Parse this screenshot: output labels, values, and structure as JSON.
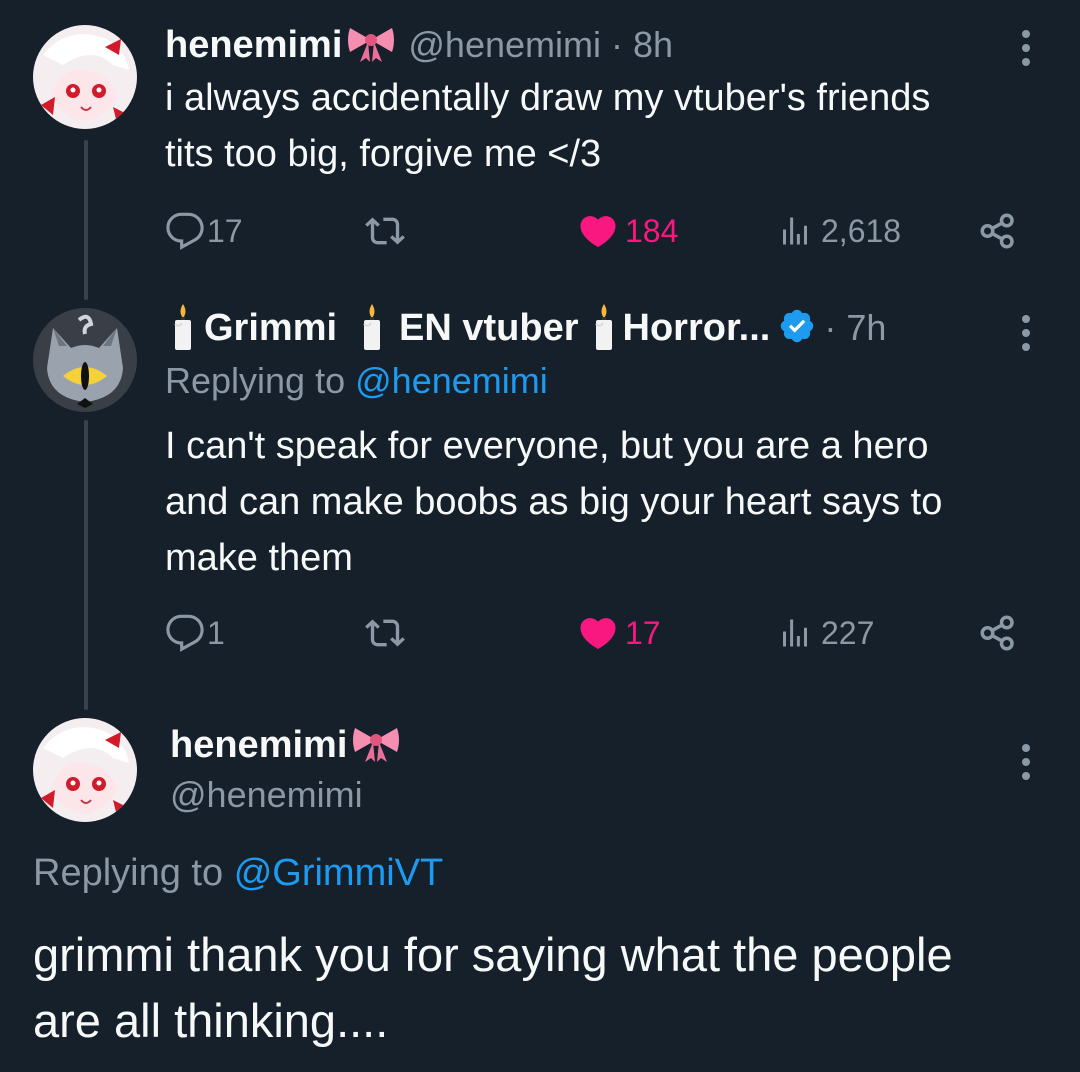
{
  "tweet1": {
    "name": "henemimi",
    "handle": "@henemimi",
    "time": "· 8h",
    "text_line1": "i always accidentally draw my vtuber's friends",
    "text_line2": "tits too big, forgive me </3",
    "replies": "17",
    "likes": "184",
    "views": "2,618"
  },
  "tweet2": {
    "name_part1": "Grimmi",
    "name_part2": "EN vtuber",
    "name_part3": "Horror...",
    "time": "· 7h",
    "replying_prefix": "Replying to",
    "replying_handle": "@henemimi",
    "text_line1": "I can't speak for everyone, but you are a hero",
    "text_line2": "and can make boobs as big your heart says to",
    "text_line3": "make them",
    "replies": "1",
    "likes": "17",
    "views": "227"
  },
  "tweet3": {
    "name": "henemimi",
    "handle": "@henemimi",
    "replying_prefix": "Replying to",
    "replying_handle": "@GrimmiVT",
    "text_line1": "grimmi thank you for saying what the people",
    "text_line2": "are all thinking...."
  },
  "colors": {
    "background": "#15202b",
    "text": "#f7f9f9",
    "muted": "#8b98a5",
    "link": "#1d9bf0",
    "like": "#f91880",
    "verified": "#1d9bf0",
    "thread_line": "#38444d"
  },
  "icons": [
    "reply-icon",
    "retweet-icon",
    "heart-icon",
    "views-icon",
    "share-icon",
    "more-icon",
    "bow-emoji",
    "candle-emoji",
    "verified-badge-icon"
  ]
}
